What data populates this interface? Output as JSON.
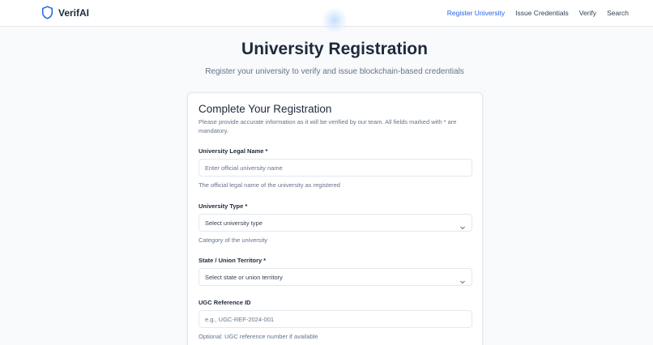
{
  "nav": {
    "brand": "VerifAI",
    "links": [
      "Register University",
      "Issue Credentials",
      "Verify",
      "Search"
    ]
  },
  "hero": {
    "title": "University Registration",
    "subtitle": "Register your university to verify and issue blockchain-based credentials"
  },
  "form": {
    "title": "Complete Your Registration",
    "description": "Please provide accurate information as it will be verified by our team. All fields marked with * are mandatory.",
    "fields": [
      {
        "label": "University Legal Name *",
        "placeholder": "Enter official university name",
        "help": "The official legal name of the university as registered"
      },
      {
        "label": "University Type *",
        "value": "Select university type",
        "help": "Category of the university"
      },
      {
        "label": "State / Union Territory *",
        "value": "Select state or union territory"
      },
      {
        "label": "UGC Reference ID",
        "placeholder": "e.g., UGC-REF-2024-001",
        "help": "Optional: UGC reference number if available"
      }
    ]
  },
  "colors": {
    "accent": "#2563eb",
    "text": "#1e293b",
    "muted": "#64748b",
    "border": "#e2e8f0"
  },
  "icons": {
    "brand": "shield-icon",
    "dropdown": "chevron-down-icon"
  }
}
